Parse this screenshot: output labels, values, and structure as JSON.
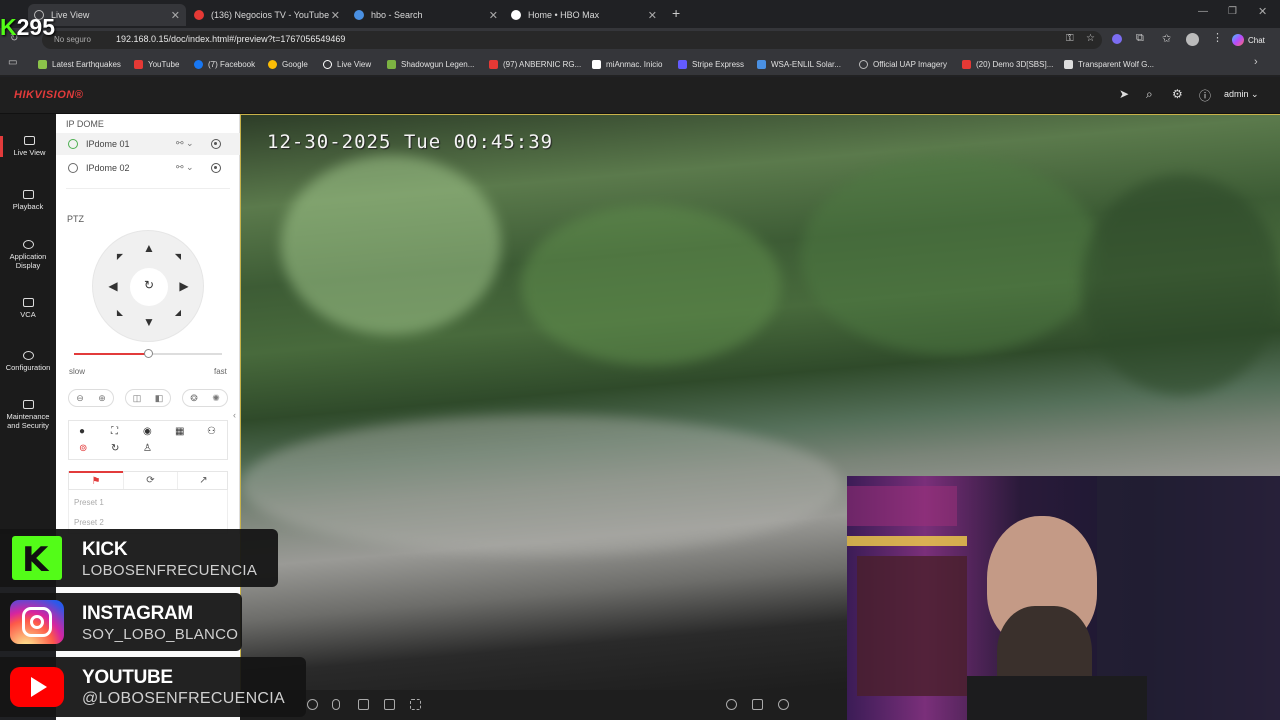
{
  "browser": {
    "tabs": [
      {
        "label": "Live View",
        "color": "#9aa0a6"
      },
      {
        "label": "(136) Negocios TV - YouTube",
        "color": "#e53935"
      },
      {
        "label": "hbo - Search",
        "color": "#4a90e2"
      },
      {
        "label": "Home • HBO Max",
        "color": "#ffffff"
      }
    ],
    "url_prefix": "No seguro",
    "url": "192.168.0.15/doc/index.html#/preview?t=1767056549469",
    "chat_label": "Chat",
    "bookmarks": [
      {
        "label": "Latest Earthquakes",
        "color": "#8bc34a"
      },
      {
        "label": "YouTube",
        "color": "#e53935"
      },
      {
        "label": "(7) Facebook",
        "color": "#1877f2"
      },
      {
        "label": "Google",
        "color": "#fbbc05"
      },
      {
        "label": "Live View",
        "color": "#ffffff"
      },
      {
        "label": "Shadowgun Legen...",
        "color": "#7cb342"
      },
      {
        "label": "(97) ANBERNIC RG...",
        "color": "#e53935"
      },
      {
        "label": "miAnmac. Inicio",
        "color": "#ffffff"
      },
      {
        "label": "Stripe Express",
        "color": "#635bff"
      },
      {
        "label": "WSA-ENLIL Solar...",
        "color": "#4a90e2"
      },
      {
        "label": "Official UAP Imagery",
        "color": "#bbbbbb"
      },
      {
        "label": "(20) Demo 3D[SBS]...",
        "color": "#e53935"
      },
      {
        "label": "Transparent Wolf G...",
        "color": "#dddddd"
      }
    ]
  },
  "app": {
    "logo": "HIKVISION®",
    "user": "admin",
    "nav": [
      {
        "label": "Live View"
      },
      {
        "label": "Playback"
      },
      {
        "label": "Application Display"
      },
      {
        "label": "VCA"
      },
      {
        "label": "Configuration"
      },
      {
        "label": "Maintenance and Security"
      }
    ],
    "device_group": "IP DOME",
    "devices": [
      "IPdome 01",
      "IPdome 02"
    ],
    "ptz_label": "PTZ",
    "speed_slow": "slow",
    "speed_fast": "fast",
    "speed_value": 0.5,
    "presets": [
      "Preset 1",
      "Preset 2"
    ]
  },
  "video": {
    "osd_timestamp": "12-30-2025 Tue 00:45:39"
  },
  "overlay": {
    "kick_count": "295",
    "socials": [
      {
        "title": "KICK",
        "handle": "LOBOSENFRECUENCIA",
        "color": "#53fc18"
      },
      {
        "title": "INSTAGRAM",
        "handle": "SOY_LOBO_BLANCO",
        "color": "#d6249f"
      },
      {
        "title": "YOUTUBE",
        "handle": "@LOBOSENFRECUENCIA",
        "color": "#ff0000"
      }
    ]
  }
}
